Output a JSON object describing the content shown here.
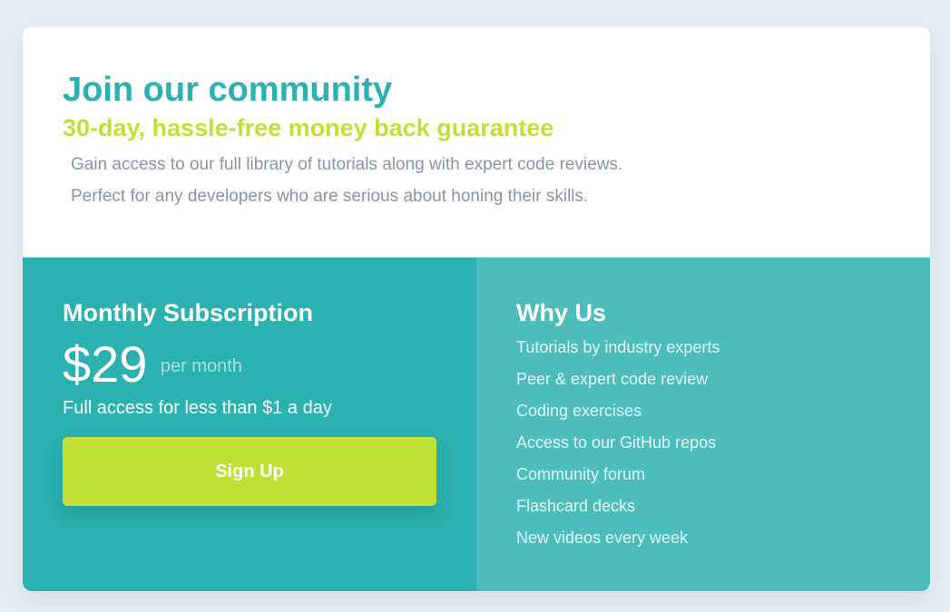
{
  "header": {
    "title": "Join our community",
    "subtitle": "30-day, hassle-free money back guarantee",
    "description_line1": "Gain access to our full library of tutorials along with expert code reviews.",
    "description_line2": "Perfect for any developers who are serious about honing their skills."
  },
  "subscription": {
    "heading": "Monthly Subscription",
    "price": "$29",
    "period": "per month",
    "note": "Full access for less than $1 a day",
    "signup_label": "Sign Up"
  },
  "why_us": {
    "heading": "Why Us",
    "items": [
      "Tutorials by industry experts",
      "Peer & expert code review",
      "Coding exercises",
      "Access to our GitHub repos",
      "Community forum",
      "Flashcard decks",
      "New videos every week"
    ]
  },
  "colors": {
    "page_background": "#e6edf5",
    "teal_primary": "#2bb1af",
    "teal_light": "#4cbdbb",
    "lime_accent": "#bfe034",
    "grey_text": "#8c949e"
  }
}
